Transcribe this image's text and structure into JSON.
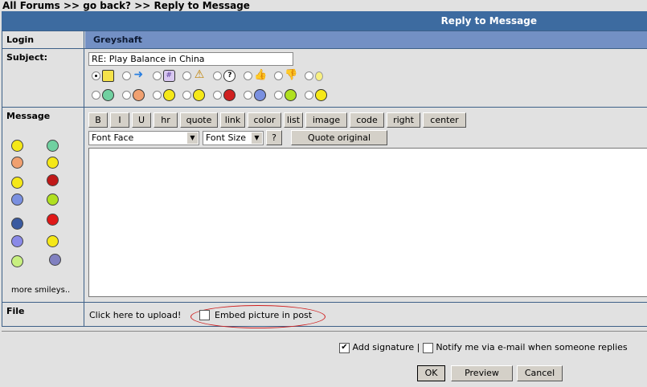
{
  "breadcrumb": {
    "all_forums": "All Forums",
    "sep": ">>",
    "go_back": "go back?",
    "current": "Reply to Message"
  },
  "header": {
    "title": "Reply to Message"
  },
  "login": {
    "label": "Login",
    "value": "Greyshaft"
  },
  "subject": {
    "label": "Subject:",
    "value": "RE: Play Balance in China",
    "icons_row1": [
      "note-icon",
      "arrow-right-icon",
      "hash-icon",
      "warning-icon",
      "question-icon",
      "thumbs-up-icon",
      "thumbs-down-icon",
      "lightbulb-icon"
    ],
    "icons_row2": [
      "grin-smiley",
      "cool-smiley",
      "wink-smiley",
      "confused-smiley",
      "angry-smiley",
      "sad-smiley",
      "smile-green-smiley",
      "smile-yellow-smiley"
    ]
  },
  "message": {
    "label": "Message",
    "more_smileys": "more smileys..",
    "toolbar": [
      "B",
      "I",
      "U",
      "hr",
      "quote",
      "link",
      "color",
      "list",
      "image",
      "code",
      "right",
      "center"
    ],
    "font_face": "Font Face",
    "font_size": "Font Size",
    "help": "?",
    "quote_original": "Quote original",
    "body": ""
  },
  "file": {
    "label": "File",
    "upload": "Click here to upload!",
    "embed": "Embed picture in post"
  },
  "footer": {
    "add_signature": "Add signature |",
    "notify": "Notify me via e-mail when someone replies",
    "ok": "OK",
    "preview": "Preview",
    "cancel": "Cancel"
  },
  "colors": {
    "header": "#3d6ba0",
    "login_bar": "#7390c4",
    "highlight": "#d02020"
  }
}
